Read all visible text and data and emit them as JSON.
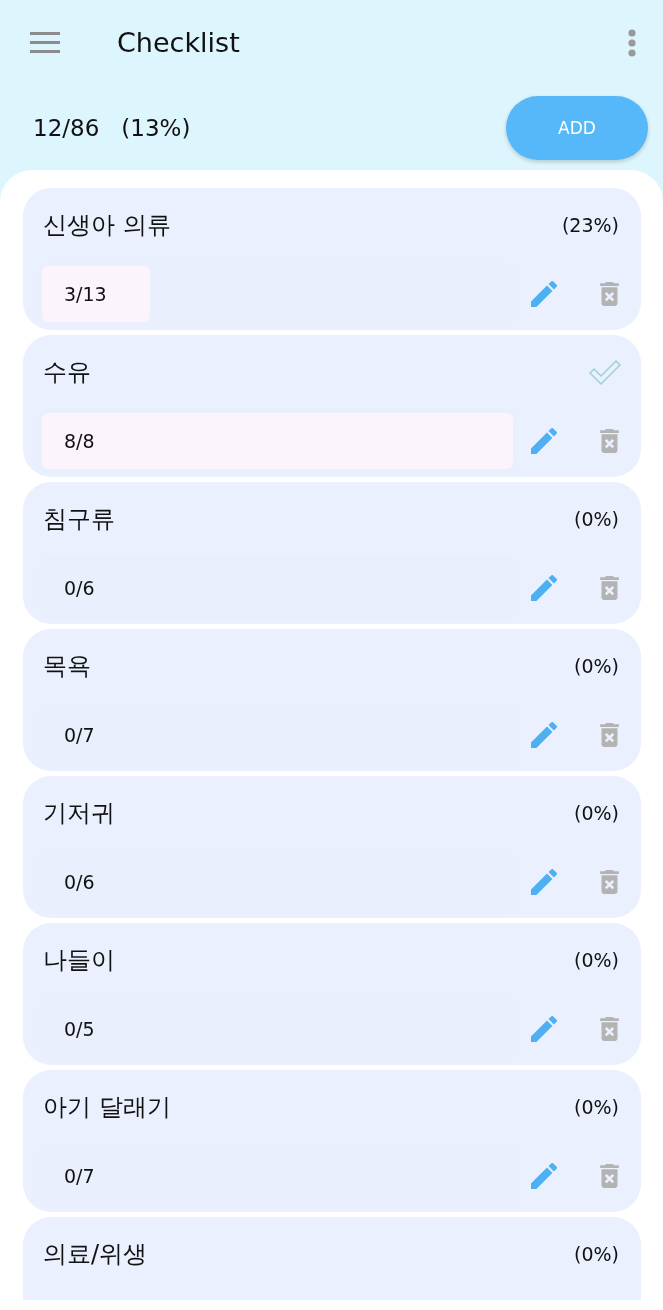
{
  "app_bar": {
    "title": "Checklist"
  },
  "summary": {
    "count": "12/86",
    "percent": "(13%)",
    "add_button": "ADD"
  },
  "categories": [
    {
      "name": "신생아 의류",
      "complete": false,
      "percent": "(23%)",
      "count": "3/13",
      "level": 0.23
    },
    {
      "name": "수유",
      "complete": true,
      "count": "8/8",
      "level": 1
    },
    {
      "name": "침구류",
      "complete": false,
      "percent": "(0%)",
      "count": "0/6",
      "level": 0
    },
    {
      "name": "목욕",
      "complete": false,
      "percent": "(0%)",
      "count": "0/7",
      "level": 0
    },
    {
      "name": "기저귀",
      "complete": false,
      "percent": "(0%)",
      "count": "0/6",
      "level": 0
    },
    {
      "name": "나들이",
      "complete": false,
      "percent": "(0%)",
      "count": "0/5",
      "level": 0
    },
    {
      "name": "아기 달래기",
      "complete": false,
      "percent": "(0%)",
      "count": "0/7",
      "level": 0
    },
    {
      "name": "의료/위생",
      "complete": false,
      "percent": "(0%)"
    }
  ]
}
